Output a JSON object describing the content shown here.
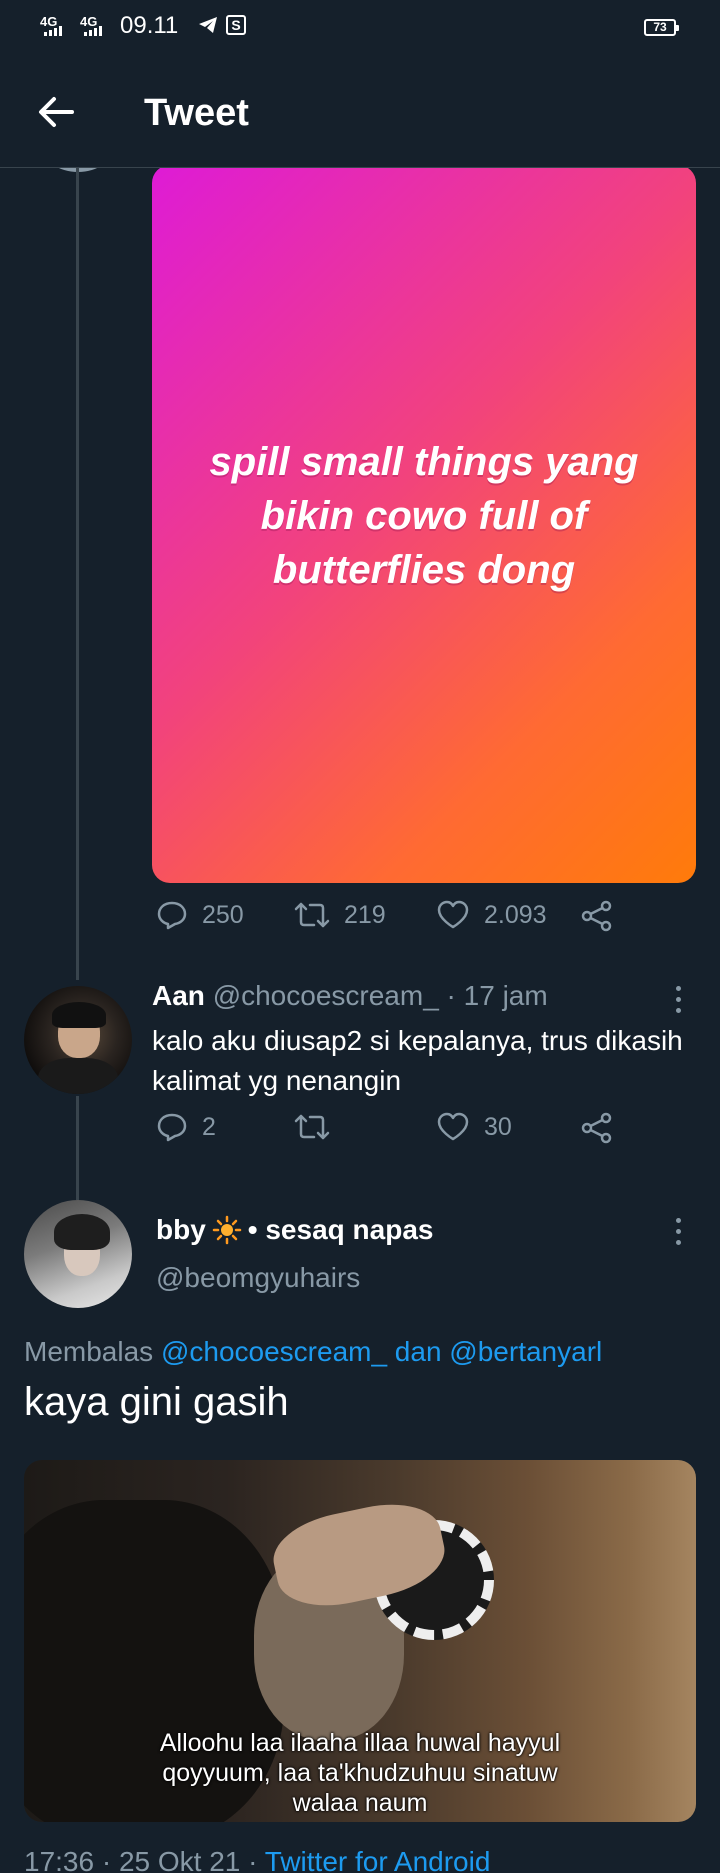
{
  "status_bar": {
    "network1": "4G",
    "network2": "4G",
    "time": "09.11",
    "battery": "73"
  },
  "header": {
    "title": "Tweet"
  },
  "original_tweet": {
    "media_text": "spill small things yang bikin cowo full of butterflies dong",
    "stats": {
      "replies": "250",
      "retweets": "219",
      "likes": "2.093"
    }
  },
  "reply": {
    "name": "Aan",
    "handle": "@chocoescream_",
    "time": "· 17 jam",
    "text": "kalo aku diusap2 si kepalanya, trus dikasih kalimat yg nenangin",
    "stats": {
      "replies": "2",
      "retweets": "",
      "likes": "30"
    }
  },
  "main_tweet": {
    "name": "bby",
    "name_suffix": "• sesaq napas",
    "name_emoji": "sun-emoji",
    "handle": "@beomgyuhairs",
    "replying_prefix": "Membalas",
    "replying_users": "@chocoescream_ dan @bertanyarl",
    "text": "kaya gini gasih",
    "media_caption_line1": "Alloohu laa ilaaha illaa huwal hayyul",
    "media_caption_line2": "qoyyuum, laa ta'khudzuhuu sinatuw",
    "media_caption_line3": "walaa naum",
    "time": "17:36",
    "date": "25 Okt 21",
    "client": "Twitter for Android"
  },
  "colors": {
    "background": "#15202b",
    "muted": "#8899a6",
    "link": "#1d9bf0",
    "divider": "#38444d"
  }
}
